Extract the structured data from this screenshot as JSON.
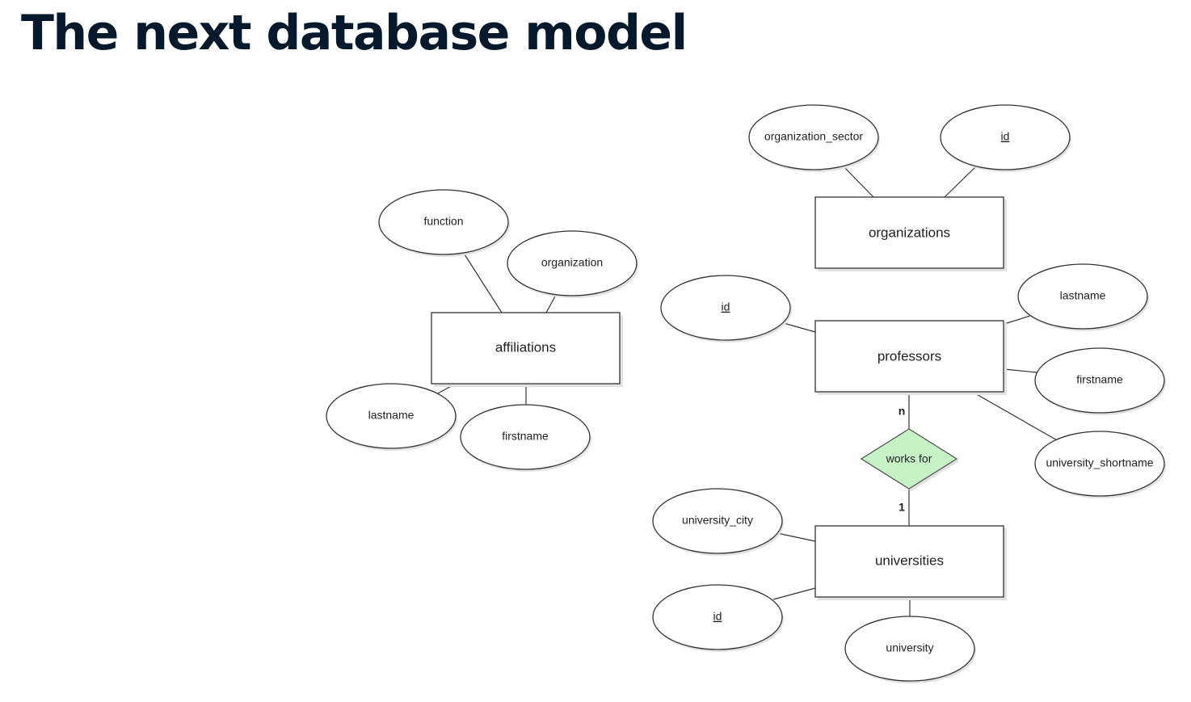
{
  "title": "The next database model",
  "colors": {
    "title": "#05192d",
    "relationship_fill": "#c6f3c6",
    "stroke": "#333333"
  },
  "entities": {
    "affiliations": {
      "label": "affiliations",
      "attributes": {
        "function": "function",
        "organization": "organization",
        "lastname": "lastname",
        "firstname": "firstname"
      }
    },
    "organizations": {
      "label": "organizations",
      "attributes": {
        "organization_sector": "organization_sector",
        "id": "id"
      }
    },
    "professors": {
      "label": "professors",
      "attributes": {
        "id": "id",
        "lastname": "lastname",
        "firstname": "firstname",
        "university_shortname": "university_shortname"
      }
    },
    "universities": {
      "label": "universities",
      "attributes": {
        "university_city": "university_city",
        "id": "id",
        "university": "university"
      }
    }
  },
  "relationships": {
    "works_for": {
      "label": "works for",
      "card_professors": "n",
      "card_universities": "1"
    }
  }
}
